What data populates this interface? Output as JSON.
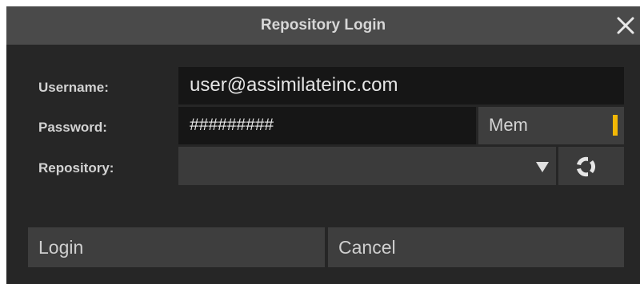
{
  "dialog": {
    "title": "Repository Login",
    "close_icon": "close-icon"
  },
  "form": {
    "username_label": "Username:",
    "username_value": "user@assimilateinc.com",
    "password_label": "Password:",
    "password_value": "#########",
    "remember_label": "Mem",
    "remember_indicator_color": "#f2b705",
    "repository_label": "Repository:",
    "repository_value": "",
    "dropdown_icon": "chevron-down-icon",
    "refresh_icon": "refresh-icon"
  },
  "actions": {
    "login_label": "Login",
    "cancel_label": "Cancel"
  }
}
